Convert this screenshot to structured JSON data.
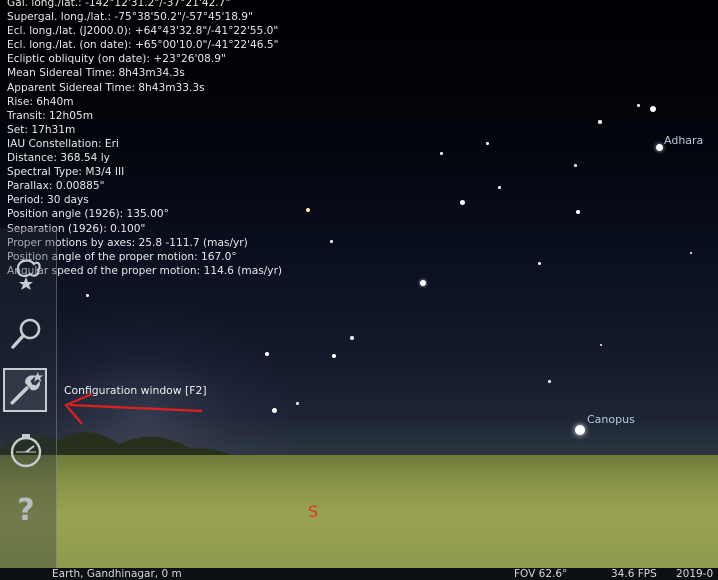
{
  "object_info": [
    "Gal. long./lat.: -142°12'31.2\"/-37°21'42.7\"",
    "Supergal. long./lat.: -75°38'50.2\"/-57°45'18.9\"",
    "Ecl. long./lat. (J2000.0): +64°43'32.8\"/-41°22'55.0\"",
    "Ecl. long./lat. (on date): +65°00'10.0\"/-41°22'46.5\"",
    "Ecliptic obliquity (on date): +23°26'08.9\"",
    "Mean Sidereal Time: 8h43m34.3s",
    "Apparent Sidereal Time: 8h43m33.3s",
    "Rise: 6h40m",
    "Transit: 12h05m",
    "Set: 17h31m",
    "IAU Constellation: Eri",
    "Distance: 368.54 ly",
    "Spectral Type: M3/4 III",
    "Parallax: 0.00885\"",
    "Period: 30 days",
    "Position angle (1926): 135.00°",
    "Separation (1926): 0.100\"",
    "Proper motions by axes: 25.8 -111.7 (mas/yr)",
    "Position angle of the proper motion: 167.0°",
    "Angular speed of the proper motion: 114.6 (mas/yr)"
  ],
  "star_labels": {
    "adhara": "Adhara",
    "canopus": "Canopus"
  },
  "toolbar": {
    "buttons": [
      {
        "icon": "sky-culture-icon"
      },
      {
        "icon": "search-icon"
      },
      {
        "icon": "configuration-wrench-icon",
        "active": true
      },
      {
        "icon": "compass-icon"
      },
      {
        "icon": "help-icon"
      }
    ],
    "tooltip": "Configuration window  [F2]"
  },
  "cardinal": {
    "south": "S"
  },
  "status_bar": {
    "location": "Earth, Gandhinagar, 0 m",
    "fov": "FOV 62.6°",
    "fps": "34.6 FPS",
    "date": "2019-0"
  },
  "colors": {
    "annotation_arrow": "#e02020",
    "cardinal_text": "#d83a2a",
    "info_text": "#e8e8e8",
    "star_label": "#b8c8e0"
  }
}
